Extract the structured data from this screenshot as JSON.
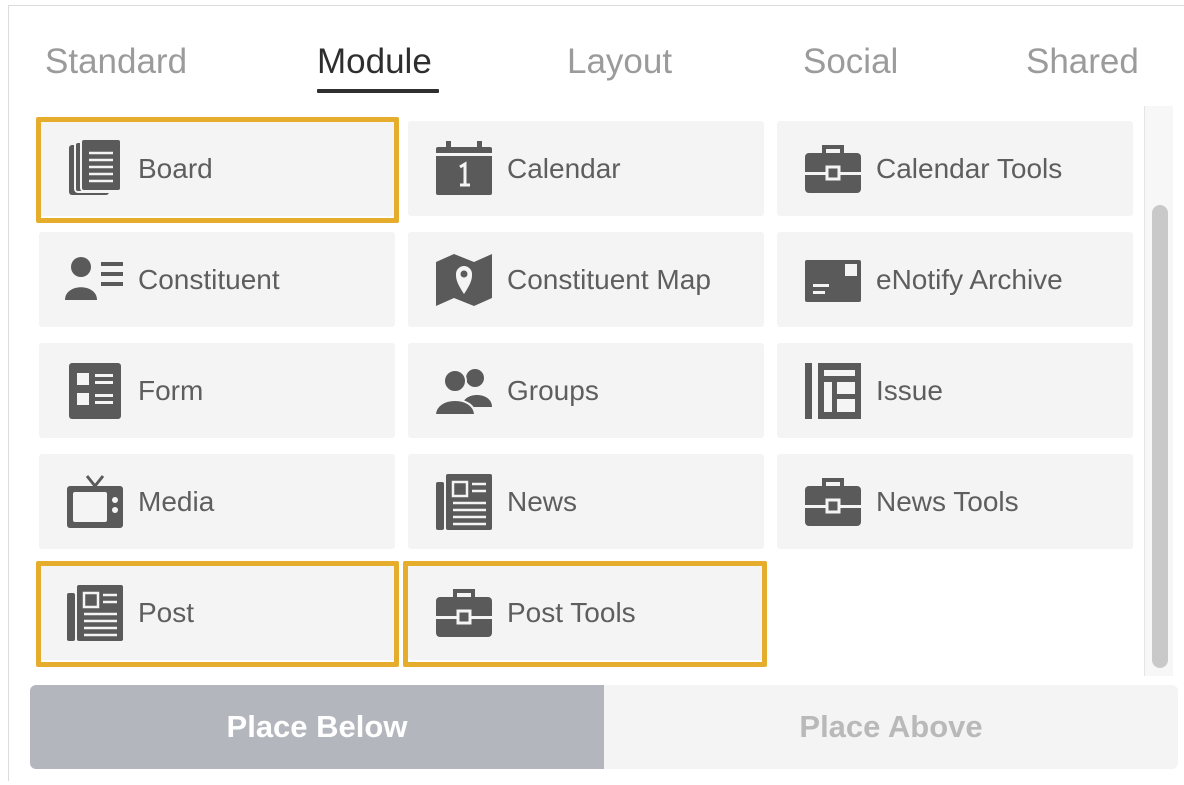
{
  "tabs": [
    {
      "label": "Standard",
      "active": false
    },
    {
      "label": "Module",
      "active": true
    },
    {
      "label": "Layout",
      "active": false
    },
    {
      "label": "Social",
      "active": false
    },
    {
      "label": "Shared",
      "active": false
    }
  ],
  "modules": [
    {
      "label": "Board",
      "icon": "board-icon",
      "highlighted": true
    },
    {
      "label": "Calendar",
      "icon": "calendar-icon",
      "highlighted": false
    },
    {
      "label": "Calendar Tools",
      "icon": "toolbox-icon",
      "highlighted": false
    },
    {
      "label": "Constituent",
      "icon": "constituent-icon",
      "highlighted": false
    },
    {
      "label": "Constituent Map",
      "icon": "map-icon",
      "highlighted": false
    },
    {
      "label": "eNotify Archive",
      "icon": "envelope-icon",
      "highlighted": false
    },
    {
      "label": "Form",
      "icon": "form-icon",
      "highlighted": false
    },
    {
      "label": "Groups",
      "icon": "groups-icon",
      "highlighted": false
    },
    {
      "label": "Issue",
      "icon": "issue-icon",
      "highlighted": false
    },
    {
      "label": "Media",
      "icon": "tv-icon",
      "highlighted": false
    },
    {
      "label": "News",
      "icon": "newspaper-icon",
      "highlighted": false
    },
    {
      "label": "News Tools",
      "icon": "toolbox-icon",
      "highlighted": false
    },
    {
      "label": "Post",
      "icon": "newspaper-icon",
      "highlighted": true
    },
    {
      "label": "Post Tools",
      "icon": "toolbox-icon",
      "highlighted": true
    }
  ],
  "actions": {
    "place_below": "Place Below",
    "place_above": "Place Above"
  },
  "colors": {
    "highlight": "#e6ac2b",
    "icon": "#5a5a5a",
    "tile_bg": "#f4f4f4",
    "active_button": "#b3b7bd"
  }
}
